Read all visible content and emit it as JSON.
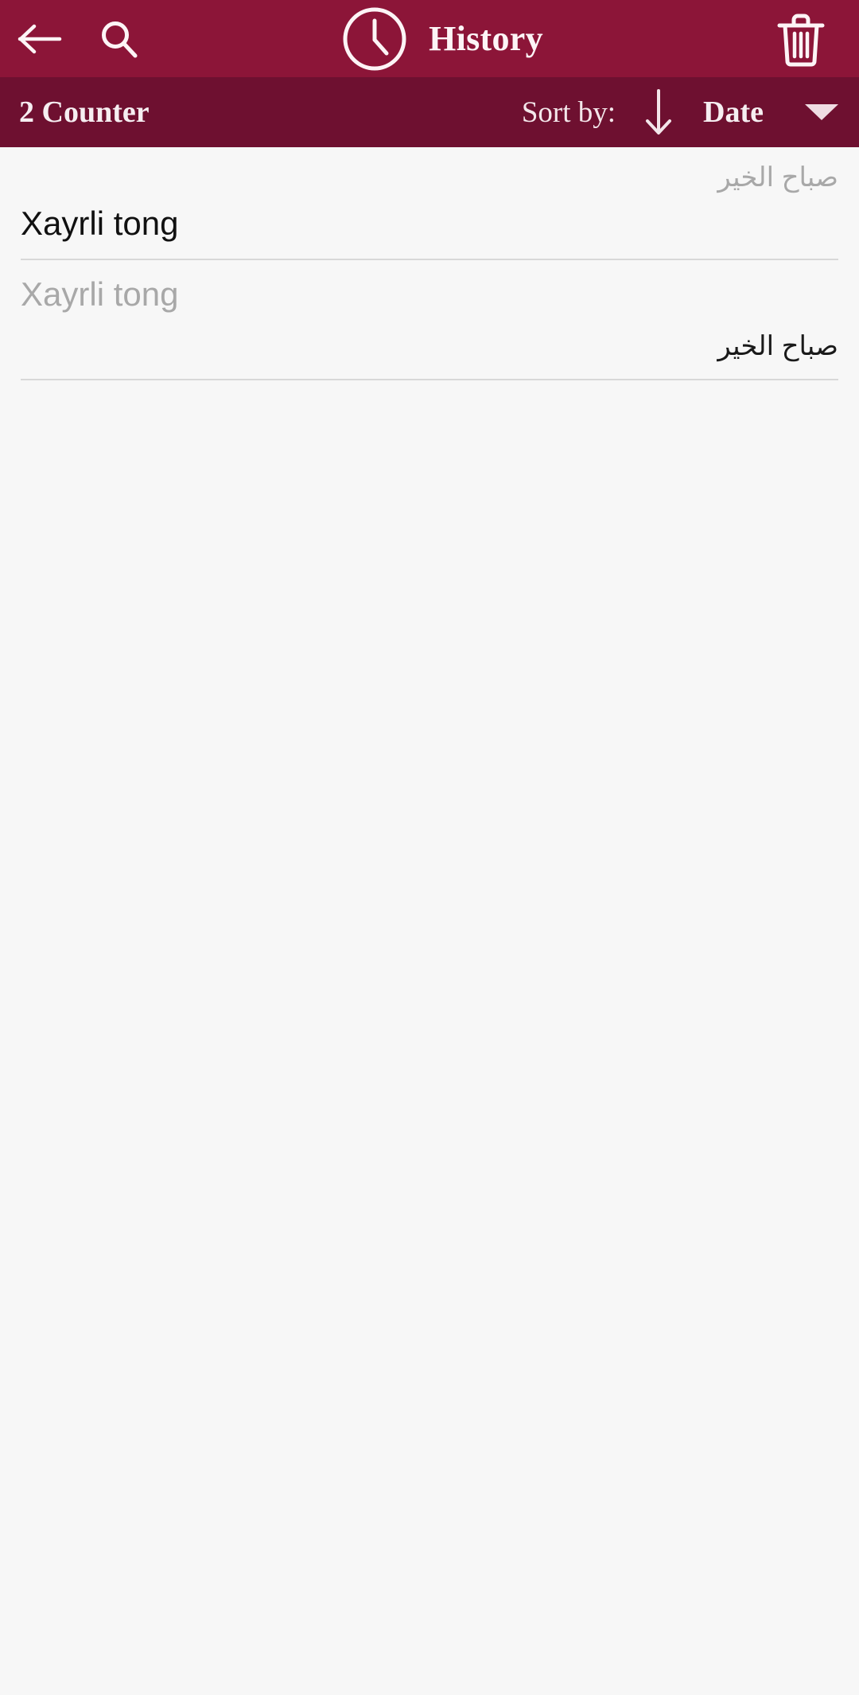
{
  "appbar": {
    "back_icon": "arrow-left-icon",
    "search_icon": "search-icon",
    "clock_icon": "clock-icon",
    "title": "History",
    "delete_icon": "trash-icon",
    "background_color": "#8c1538",
    "foreground_color": "#fdf4f6"
  },
  "subbar": {
    "counter_label": "2 Counter",
    "sort_label": "Sort by:",
    "sort_direction_icon": "arrow-down-icon",
    "sort_value": "Date",
    "dropdown_icon": "caret-down-icon",
    "background_color": "#6e1030"
  },
  "history": {
    "entries": [
      {
        "source_text": "صباح الخير",
        "target_text": "Xayrli tong"
      },
      {
        "source_text": "صباح الخير",
        "target_text": "Xayrli tong"
      }
    ]
  }
}
